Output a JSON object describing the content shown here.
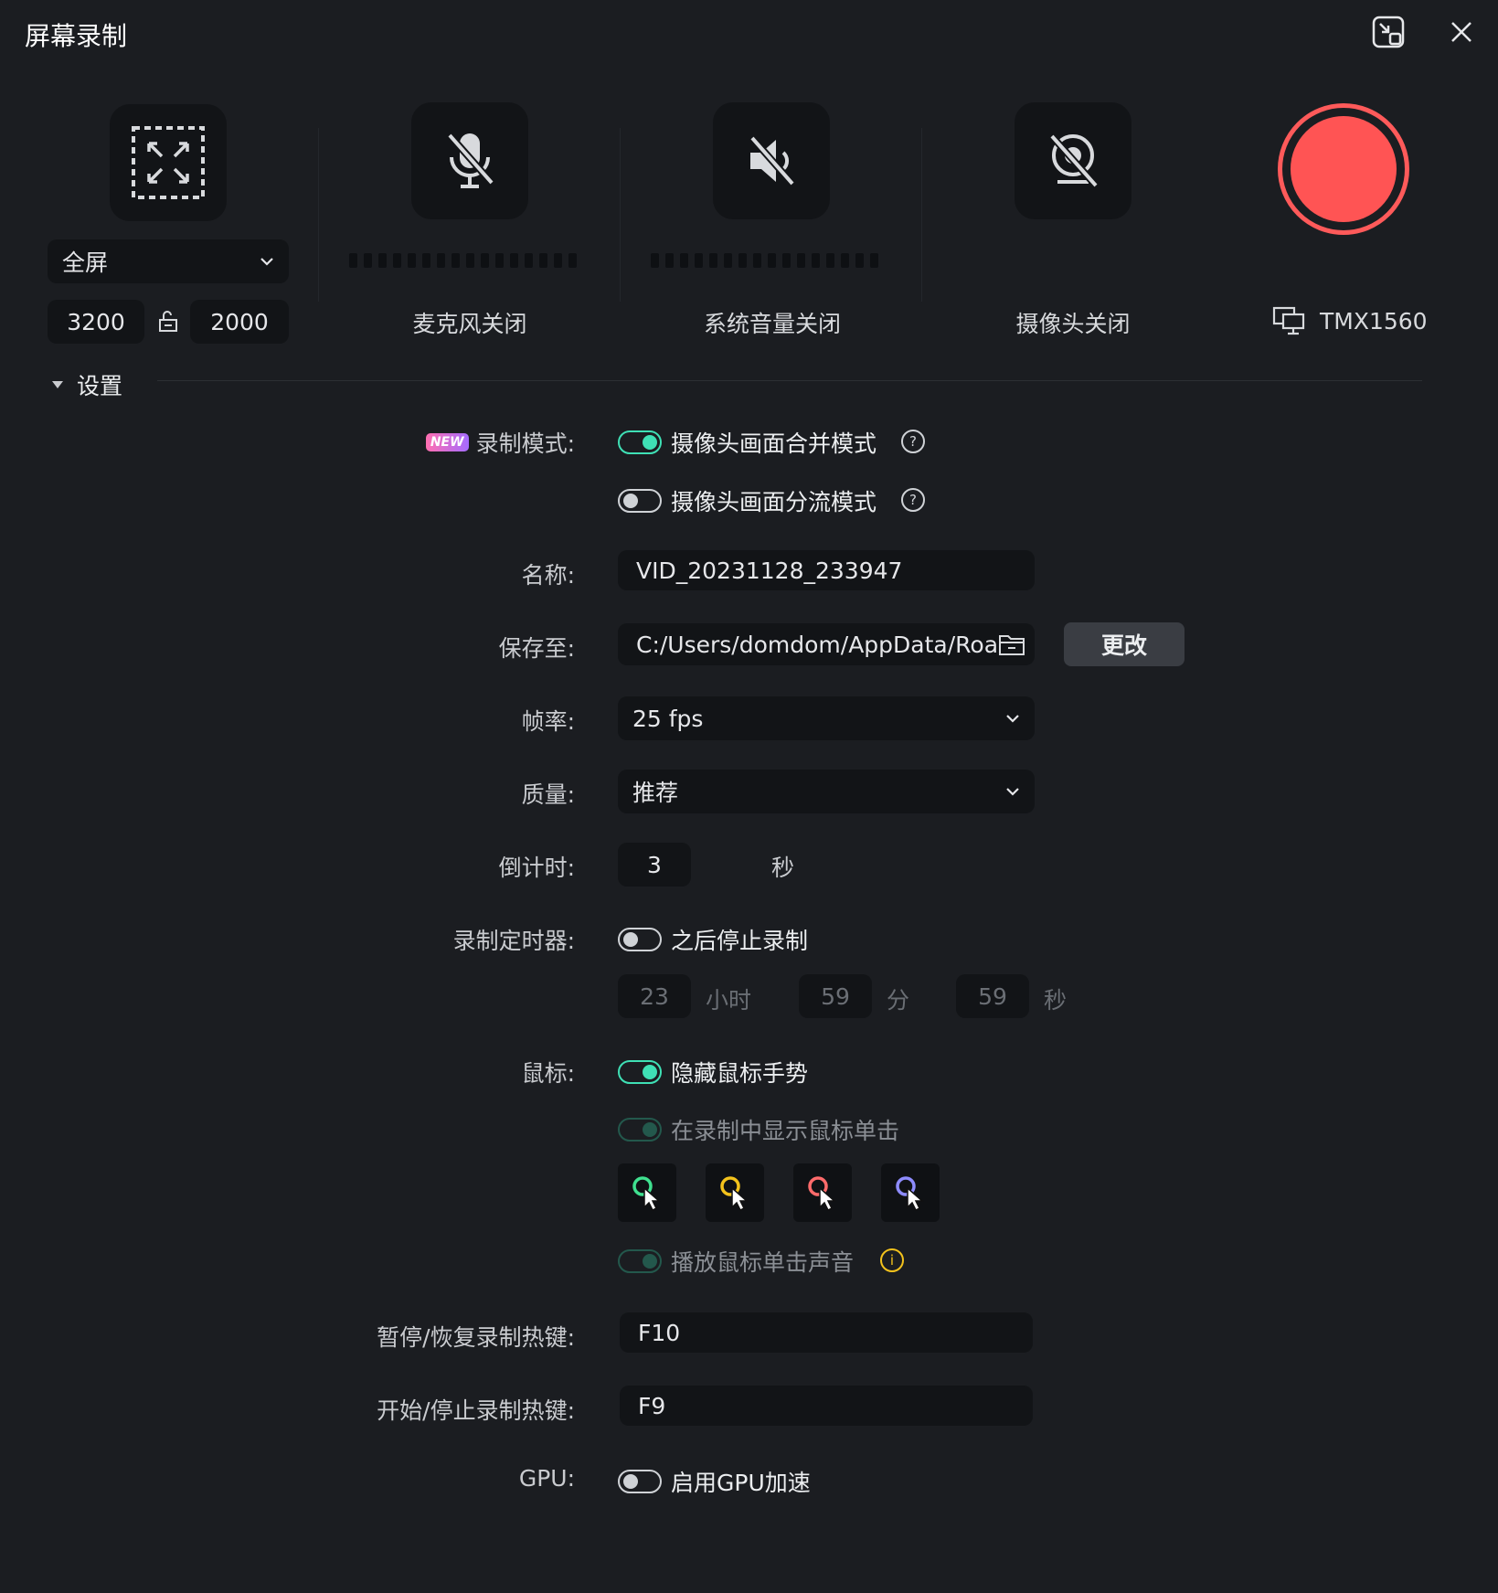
{
  "window": {
    "title": "屏幕录制"
  },
  "capture": {
    "mode_selected": "全屏",
    "width": "3200",
    "height": "2000"
  },
  "devices": {
    "mic_label": "麦克风关闭",
    "system_audio_label": "系统音量关闭",
    "camera_label": "摄像头关闭",
    "display_name": "TMX1560"
  },
  "settings": {
    "section_title": "设置",
    "record_mode": {
      "badge": "NEW",
      "label": "录制模式:",
      "option1": "摄像头画面合并模式",
      "option2": "摄像头画面分流模式"
    },
    "name": {
      "label": "名称:",
      "value": "VID_20231128_233947"
    },
    "save_to": {
      "label": "保存至:",
      "value": "C:/Users/domdom/AppData/Roa",
      "change_label": "更改"
    },
    "frame_rate": {
      "label": "帧率:",
      "value": "25 fps"
    },
    "quality": {
      "label": "质量:",
      "value": "推荐"
    },
    "countdown": {
      "label": "倒计时:",
      "value": "3",
      "unit": "秒"
    },
    "timer": {
      "label": "录制定时器:",
      "toggle_label": "之后停止录制",
      "hours": "23",
      "hours_unit": "小时",
      "minutes": "59",
      "minutes_unit": "分",
      "seconds": "59",
      "seconds_unit": "秒"
    },
    "mouse": {
      "label": "鼠标:",
      "hide_gesture": "隐藏鼠标手势",
      "show_clicks": "在录制中显示鼠标单击",
      "play_sound": "播放鼠标单击声音",
      "cursor_colors": [
        "#3fe08f",
        "#f3c21c",
        "#ff6b6b",
        "#8e8cff"
      ]
    },
    "hotkey_pause": {
      "label": "暂停/恢复录制热键:",
      "value": "F10"
    },
    "hotkey_start": {
      "label": "开始/停止录制热键:",
      "value": "F9"
    },
    "gpu": {
      "label": "GPU:",
      "toggle_label": "启用GPU加速"
    }
  },
  "colors": {
    "accent": "#3fe0b5",
    "record": "#ff5454",
    "warning": "#f3c21c"
  }
}
